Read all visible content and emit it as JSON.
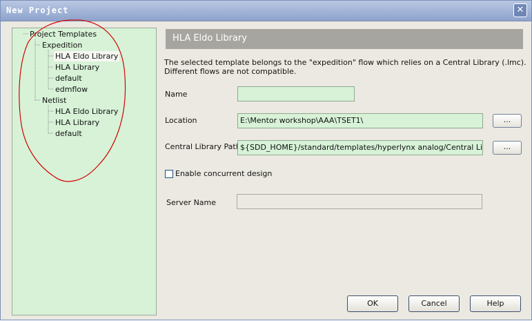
{
  "window": {
    "title": "New Project",
    "close_glyph": "✕",
    "close_icon": "close-icon"
  },
  "tree": {
    "root": "Project Templates",
    "groups": [
      {
        "label": "Expedition",
        "items": [
          "HLA Eldo Library",
          "HLA Library",
          "default",
          "edmflow"
        ]
      },
      {
        "label": "Netlist",
        "items": [
          "HLA Eldo Library",
          "HLA Library",
          "default"
        ]
      }
    ],
    "selected": "Expedition / HLA Eldo Library"
  },
  "template_header": "HLA Eldo Library",
  "description": "The selected template belongs to the \"expedition\" flow which relies on a Central Library (.lmc). Different flows are not compatible.",
  "form": {
    "name_label": "Name",
    "name_value": "",
    "location_label": "Location",
    "location_value": "E:\\Mentor workshop\\AAA\\TSET1\\",
    "location_browse": "...",
    "central_library_label": "Central Library Path",
    "central_library_value": "${SDD_HOME}/standard/templates/hyperlynx analog/Central Library/Ap$",
    "central_library_browse": "...",
    "concurrent_label": "Enable concurrent design",
    "concurrent_checked": false,
    "server_name_label": "Server Name",
    "server_name_value": ""
  },
  "buttons": {
    "ok": "OK",
    "cancel": "Cancel",
    "help": "Help"
  },
  "colors": {
    "panel_green": "#d7f2d7",
    "header_gray": "#a7a5a0",
    "annotation_red": "#d40000"
  }
}
